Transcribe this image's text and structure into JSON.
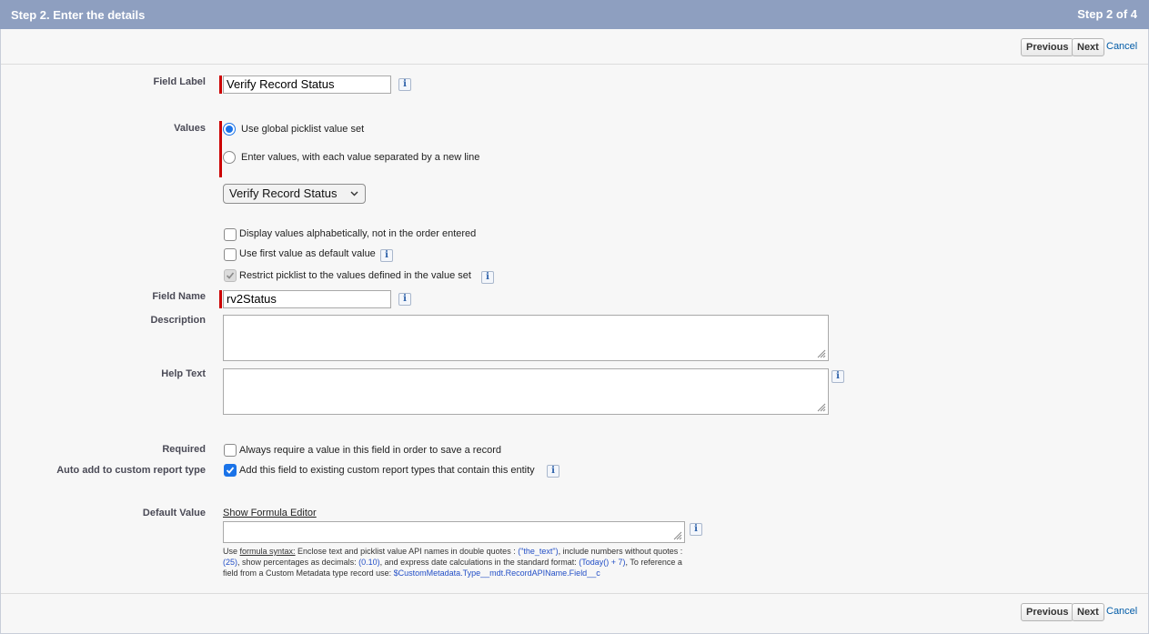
{
  "header": {
    "title": "Step 2. Enter the details",
    "step": "Step 2 of 4"
  },
  "buttons": {
    "previous": "Previous",
    "next": "Next",
    "cancel": "Cancel"
  },
  "form": {
    "field_label": {
      "label": "Field Label",
      "value": "Verify Record Status"
    },
    "values": {
      "label": "Values",
      "option_global": "Use global picklist value set",
      "option_enter": "Enter values, with each value separated by a new line",
      "selected_option": "global",
      "picklist_value_set": "Verify Record Status",
      "checkbox_alpha": "Display values alphabetically, not in the order entered",
      "checkbox_alpha_checked": false,
      "checkbox_default": "Use first value as default value",
      "checkbox_default_checked": false,
      "checkbox_restrict": "Restrict picklist to the values defined in the value set",
      "checkbox_restrict_checked": true
    },
    "field_name": {
      "label": "Field Name",
      "value": "rv2Status"
    },
    "description": {
      "label": "Description",
      "value": ""
    },
    "help_text": {
      "label": "Help Text",
      "value": ""
    },
    "required": {
      "label": "Required",
      "text": "Always require a value in this field in order to save a record",
      "checked": false
    },
    "auto_add": {
      "label": "Auto add to custom report type",
      "text": "Add this field to existing custom report types that contain this entity",
      "checked": true
    },
    "default_value": {
      "label": "Default Value",
      "formula_link": "Show Formula Editor",
      "value": "",
      "hint_use": "Use ",
      "hint_formula_syntax": "formula syntax:",
      "hint_part1": " Enclose text and picklist value API names in double quotes : ",
      "hint_ex1": "(\"the_text\")",
      "hint_part2": ", include numbers without quotes : ",
      "hint_ex2": "(25)",
      "hint_part3": ", show percentages as decimals: ",
      "hint_ex3": "(0.10)",
      "hint_part4": ", and express date calculations in the standard format: ",
      "hint_ex4": "(Today() + 7)",
      "hint_part5": ", To reference a field from a Custom Metadata type record use: ",
      "hint_ex5": "$CustomMetadata.Type__mdt.RecordAPIName.Field__c"
    }
  },
  "colors": {
    "header_bg": "#8e9fc0",
    "required_bar": "#cc0000",
    "accent": "#1a73e8",
    "link": "#015ba7"
  }
}
